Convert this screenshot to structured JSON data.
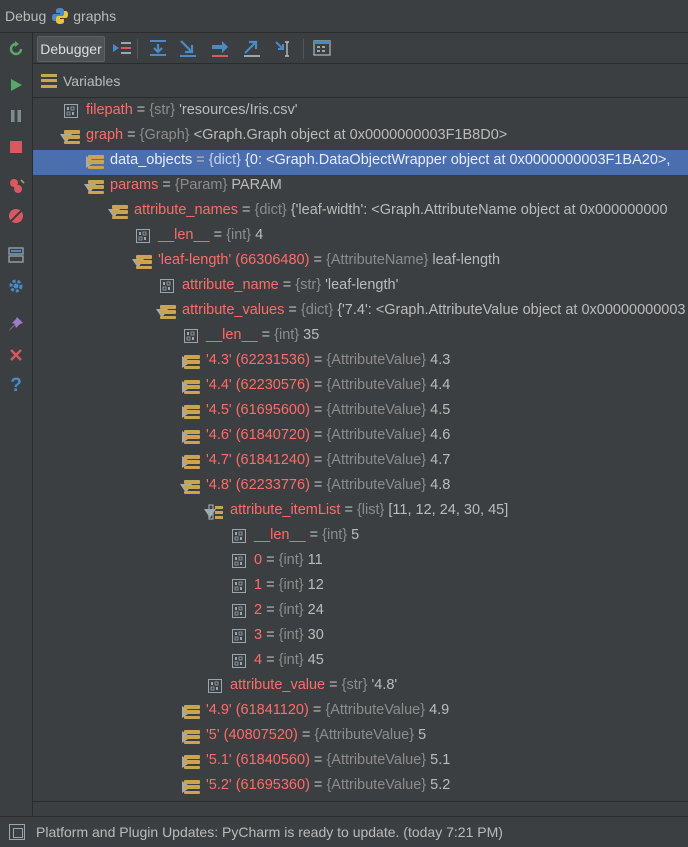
{
  "window": {
    "panel_title": "Debug",
    "config_name": "graphs"
  },
  "toolbar": {
    "debugger_tab": "Debugger"
  },
  "variables_panel": {
    "title": "Variables"
  },
  "tree": [
    {
      "indent": 0,
      "toggle": "none",
      "icon": "prim",
      "name": "filepath",
      "type": "{str}",
      "value": "'resources/Iris.csv'"
    },
    {
      "indent": 0,
      "toggle": "expanded",
      "icon": "struct",
      "name": "graph",
      "type": "{Graph}",
      "value": "<Graph.Graph object at 0x0000000003F1B8D0>"
    },
    {
      "indent": 1,
      "toggle": "collapsed",
      "icon": "struct",
      "name": "data_objects",
      "type": "{dict}",
      "value": "{0: <Graph.DataObjectWrapper object at 0x0000000003F1BA20>,",
      "selected": true
    },
    {
      "indent": 1,
      "toggle": "expanded",
      "icon": "struct",
      "name": "params",
      "type": "{Param}",
      "value": "PARAM"
    },
    {
      "indent": 2,
      "toggle": "expanded",
      "icon": "struct",
      "name": "attribute_names",
      "type": "{dict}",
      "value": "{'leaf-width': <Graph.AttributeName object at 0x000000000"
    },
    {
      "indent": 3,
      "toggle": "none",
      "icon": "prim",
      "name": "__len__",
      "type": "{int}",
      "value": "4"
    },
    {
      "indent": 3,
      "toggle": "expanded",
      "icon": "struct",
      "name": "'leaf-length' (66306480)",
      "type": "{AttributeName}",
      "value": "leaf-length"
    },
    {
      "indent": 4,
      "toggle": "none",
      "icon": "prim",
      "name": "attribute_name",
      "type": "{str}",
      "value": "'leaf-length'"
    },
    {
      "indent": 4,
      "toggle": "expanded",
      "icon": "struct",
      "name": "attribute_values",
      "type": "{dict}",
      "value": "{'7.4': <Graph.AttributeValue object at 0x00000000003"
    },
    {
      "indent": 5,
      "toggle": "none",
      "icon": "prim",
      "name": "__len__",
      "type": "{int}",
      "value": "35"
    },
    {
      "indent": 5,
      "toggle": "collapsed",
      "icon": "struct",
      "name": "'4.3' (62231536)",
      "type": "{AttributeValue}",
      "value": "4.3"
    },
    {
      "indent": 5,
      "toggle": "collapsed",
      "icon": "struct",
      "name": "'4.4' (62230576)",
      "type": "{AttributeValue}",
      "value": "4.4"
    },
    {
      "indent": 5,
      "toggle": "collapsed",
      "icon": "struct",
      "name": "'4.5' (61695600)",
      "type": "{AttributeValue}",
      "value": "4.5"
    },
    {
      "indent": 5,
      "toggle": "collapsed",
      "icon": "struct",
      "name": "'4.6' (61840720)",
      "type": "{AttributeValue}",
      "value": "4.6"
    },
    {
      "indent": 5,
      "toggle": "collapsed",
      "icon": "struct",
      "name": "'4.7' (61841240)",
      "type": "{AttributeValue}",
      "value": "4.7"
    },
    {
      "indent": 5,
      "toggle": "expanded",
      "icon": "struct",
      "name": "'4.8' (62233776)",
      "type": "{AttributeValue}",
      "value": "4.8"
    },
    {
      "indent": 6,
      "toggle": "expanded",
      "icon": "list",
      "name": "attribute_itemList",
      "type": "{list}",
      "value": "[11, 12, 24, 30, 45]"
    },
    {
      "indent": 7,
      "toggle": "none",
      "icon": "prim",
      "name": "__len__",
      "type": "{int}",
      "value": "5"
    },
    {
      "indent": 7,
      "toggle": "none",
      "icon": "prim",
      "name": "0",
      "type": "{int}",
      "value": "11"
    },
    {
      "indent": 7,
      "toggle": "none",
      "icon": "prim",
      "name": "1",
      "type": "{int}",
      "value": "12"
    },
    {
      "indent": 7,
      "toggle": "none",
      "icon": "prim",
      "name": "2",
      "type": "{int}",
      "value": "24"
    },
    {
      "indent": 7,
      "toggle": "none",
      "icon": "prim",
      "name": "3",
      "type": "{int}",
      "value": "30"
    },
    {
      "indent": 7,
      "toggle": "none",
      "icon": "prim",
      "name": "4",
      "type": "{int}",
      "value": "45"
    },
    {
      "indent": 6,
      "toggle": "none",
      "icon": "prim",
      "name": "attribute_value",
      "type": "{str}",
      "value": "'4.8'"
    },
    {
      "indent": 5,
      "toggle": "collapsed",
      "icon": "struct",
      "name": "'4.9' (61841120)",
      "type": "{AttributeValue}",
      "value": "4.9"
    },
    {
      "indent": 5,
      "toggle": "collapsed",
      "icon": "struct",
      "name": "'5' (40807520)",
      "type": "{AttributeValue}",
      "value": "5"
    },
    {
      "indent": 5,
      "toggle": "collapsed",
      "icon": "struct",
      "name": "'5.1' (61840560)",
      "type": "{AttributeValue}",
      "value": "5.1"
    },
    {
      "indent": 5,
      "toggle": "collapsed",
      "icon": "struct",
      "name": "'5.2' (61695360)",
      "type": "{AttributeValue}",
      "value": "5.2"
    }
  ],
  "statusbar": {
    "message": "Platform and Plugin Updates: PyCharm is ready to update. (today 7:21 PM)"
  },
  "colors": {
    "background": "#3c3f41",
    "selection": "#4b6eaf",
    "name": "#ff6b68",
    "type": "#8c8c8c",
    "struct_icon": "#c9a552"
  }
}
